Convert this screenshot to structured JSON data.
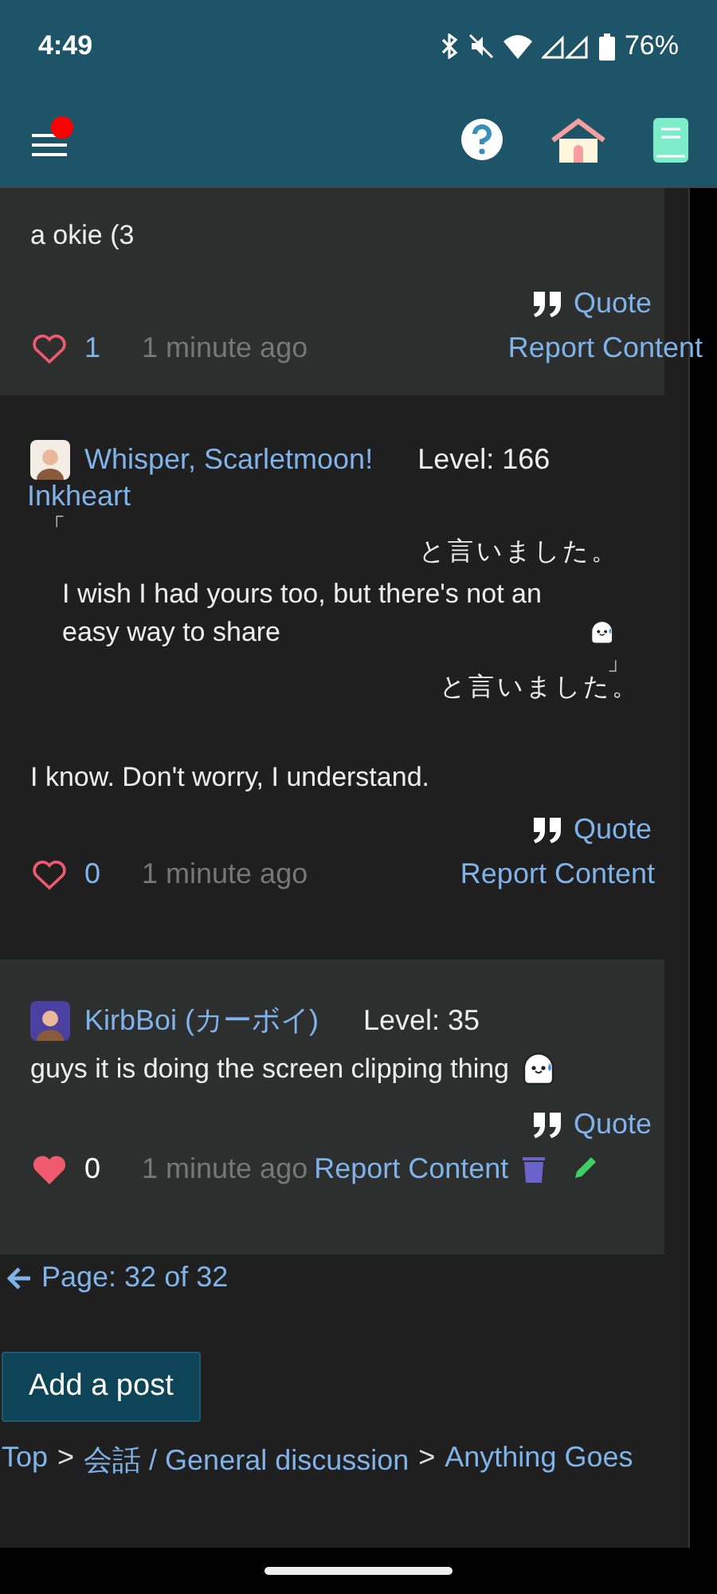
{
  "status_bar": {
    "time": "4:49",
    "battery": "76%"
  },
  "header": {
    "menu_notification": true
  },
  "posts": [
    {
      "card": true,
      "body": "a okie (3",
      "body_emoji": false,
      "quote_label": "Quote",
      "liked": false,
      "likes": "1",
      "time": "1 minute ago",
      "report": "Report Content",
      "can_edit": false
    },
    {
      "card": false,
      "author": "Whisper, Scarletmoon!",
      "author_line2": "Inkheart",
      "level": "Level: 166",
      "color": "#f4ede6",
      "quote": {
        "open_mark": "「",
        "said_top": "と言いました。",
        "text": "I wish I had yours too, but there's not an easy way to share",
        "emoji": true,
        "close_mark": "」",
        "said_bottom": "と言いました。"
      },
      "body": "I know. Don't worry, I understand.",
      "body_emoji": false,
      "quote_label": "Quote",
      "liked": false,
      "likes": "0",
      "time": "1 minute ago",
      "report": "Report Content",
      "can_edit": false
    },
    {
      "card": true,
      "author": "KirbBoi (カーボイ)",
      "level": "Level: 35",
      "color": "#4b3fa0",
      "body": "guys it is doing the screen clipping thing",
      "body_emoji": true,
      "quote_label": "Quote",
      "liked": true,
      "likes": "0",
      "time": "1 minute ago",
      "report": "Report Content",
      "can_edit": true
    }
  ],
  "pagination": "Page: 32 of 32",
  "add_button": "Add a post",
  "breadcrumb": [
    {
      "kind": "link",
      "text": "Top"
    },
    {
      "kind": "separator",
      "text": ">"
    },
    {
      "kind": "link",
      "text": "会話 / General discussion"
    },
    {
      "kind": "separator",
      "text": ">"
    },
    {
      "kind": "link",
      "text": "Anything Goes"
    }
  ]
}
